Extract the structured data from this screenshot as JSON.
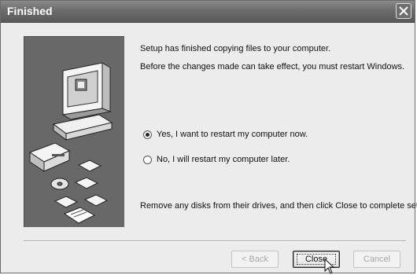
{
  "window": {
    "title": "Finished"
  },
  "content": {
    "line1": "Setup has finished copying files to your computer.",
    "line2": "Before the changes made can take effect, you must restart Windows.",
    "option_yes": "Yes, I want to restart my computer now.",
    "option_no": "No, I will restart my computer later.",
    "selected_option": "yes",
    "footer_text": "Remove any disks from their drives, and then click Close to complete setup."
  },
  "buttons": {
    "back": "< Back",
    "close": "Close",
    "cancel": "Cancel"
  },
  "icons": {
    "title_close": "close-x-icon",
    "illustration": "computer-setup-illustration",
    "pointer": "mouse-pointer-icon"
  },
  "colors": {
    "titlebar": "#6c6c6c",
    "dialog_bg": "#ececec",
    "art_panel": "#686868"
  }
}
